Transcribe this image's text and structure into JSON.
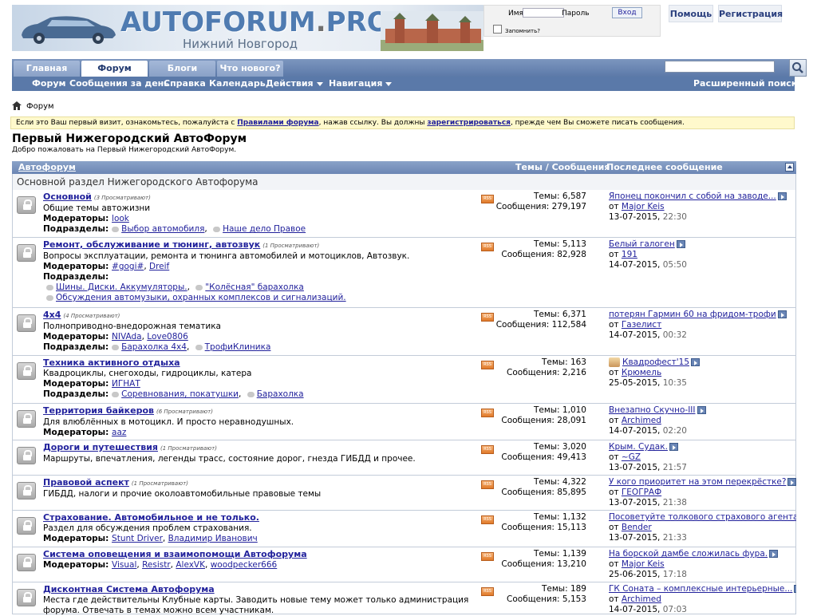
{
  "header": {
    "logo_text": "AUTOFORUM",
    "logo_dot": ".",
    "logo_suffix": "PRO",
    "logo_subtitle": "Нижний Новгород",
    "login": {
      "username_label": "Имя",
      "password_label": "Пароль",
      "login_button": "Вход",
      "remember_label": "Запомнить?"
    },
    "help_link": "Помощь",
    "register_link": "Регистрация"
  },
  "nav": {
    "tabs": [
      "Главная",
      "Форум",
      "Блоги",
      "Что нового?"
    ],
    "active_tab": "Форум",
    "subnav": [
      "Форум",
      "Сообщения за день",
      "Справка",
      "Календарь",
      "Действия",
      "Навигация"
    ],
    "advanced_search": "Расширенный поиск"
  },
  "breadcrumb": "Форум",
  "notice": {
    "part1": "Если это Ваш первый визит, ознакомьтесь, пожалуйста с ",
    "link1": "Правилами форума",
    "part2": ", нажав ссылку. Вы должны ",
    "link2": "зарегистрироваться",
    "part3": ", прежде чем Вы сможете писать сообщения."
  },
  "page": {
    "title": "Первый Нижегородский АвтоФорум",
    "subtitle": "Добро пожаловать на Первый Нижегородский АвтоФорум."
  },
  "forum_table": {
    "category": "Автофорум",
    "col_threads_posts": "Темы / Сообщения",
    "col_last_post": "Последнее сообщение",
    "category_desc": "Основной раздел Нижегородского Автофорума",
    "labels": {
      "moderators": "Модераторы:",
      "subforums": "Подразделы:",
      "threads": "Темы:",
      "posts": "Сообщения:",
      "from": "от",
      "rss": "RSS"
    },
    "forums": [
      {
        "title": "Основной",
        "viewing": "(3 Просматривают)",
        "desc": "Общие темы автожизни",
        "moderators": [
          "look"
        ],
        "subforums": [
          [
            "Выбор автомобиля",
            "Наше дело Правое"
          ]
        ],
        "threads": "6,587",
        "posts": "279,197",
        "last_title": "Японец покончил с собой на заводе...",
        "last_user": "Major Keis",
        "last_date": "13-07-2015,",
        "last_time": "22:30",
        "height": 60
      },
      {
        "title": "Ремонт, обслуживание и тюнинг, автозвук",
        "viewing": "(1 Просматривают)",
        "desc": "Вопросы эксплуатации, ремонта и тюнинга автомобилей и мотоциклов, Автозвук.",
        "moderators": [
          "#gogi#",
          "Dreif"
        ],
        "subforums_newline": true,
        "subforums": [
          [
            "Шины. Диски. Аккумуляторы.",
            "\"Колёсная\" барахолка"
          ],
          [
            "Обсуждения автомузыки, охранных комплексов и сигнализаций."
          ]
        ],
        "threads": "5,113",
        "posts": "82,928",
        "last_title": "Белый галоген",
        "last_user": "191",
        "last_date": "14-07-2015,",
        "last_time": "05:50",
        "height": 88
      },
      {
        "title": "4x4",
        "viewing": "(4 Просматривают)",
        "desc": "Полноприводно-внедорожная тематика",
        "moderators": [
          "NIVAda",
          "Love0806"
        ],
        "subforums": [
          [
            "Барахолка 4x4",
            "ТрофиКлиника"
          ]
        ],
        "threads": "6,371",
        "posts": "112,584",
        "last_title": "потерян Гармин 60 на фридом-трофи",
        "last_user": "Газелист",
        "last_date": "14-07-2015,",
        "last_time": "00:32",
        "height": 60
      },
      {
        "title": "Техника активного отдыха",
        "viewing": "",
        "desc": "Квадроциклы, снегоходы, гидроциклы, катера",
        "moderators": [
          "ИГНАТ"
        ],
        "subforums": [
          [
            "Соревнования, покатушки",
            "Барахолка"
          ]
        ],
        "threads": "163",
        "posts": "2,216",
        "last_title": "Квадрофест'15",
        "last_user": "Крюмель",
        "last_icon": true,
        "last_date": "25-05-2015,",
        "last_time": "10:35",
        "height": 60
      },
      {
        "title": "Территория байкеров",
        "viewing": "(6 Просматривают)",
        "desc": "Для влюблённых в мотоцикл. И просто неравнодушных.",
        "moderators": [
          "aaz"
        ],
        "subforums": [],
        "threads": "1,010",
        "posts": "28,091",
        "last_title": "Внезапно Скучно-III",
        "last_user": "Archimed",
        "last_date": "14-07-2015,",
        "last_time": "02:20",
        "height": 46
      },
      {
        "title": "Дороги и путешествия",
        "viewing": "(1 Просматривают)",
        "desc": "Маршруты, впечатления, легенды трасс, состояние дорог, гнезда ГИБДД и прочее.",
        "moderators": [],
        "subforums": [],
        "threads": "3,020",
        "posts": "49,413",
        "last_title": "Крым. Судак.",
        "last_user": "~GZ",
        "last_date": "13-07-2015,",
        "last_time": "21:57",
        "height": 44
      },
      {
        "title": "Правовой аспект",
        "viewing": "(1 Просматривают)",
        "desc": "ГИБДД, налоги и прочие околоавтомобильные правовые темы",
        "moderators": [],
        "subforums": [],
        "threads": "4,322",
        "posts": "85,895",
        "last_title": "У кого приоритет на этом перекрёстке?",
        "last_user": "ГЕОГРАФ",
        "last_date": "13-07-2015,",
        "last_time": "21:38",
        "height": 44
      },
      {
        "title": "Страхование. Автомобильное и не только.",
        "viewing": "",
        "desc": "Раздел для обсуждения проблем страхования.",
        "moderators": [
          "Stunt Driver",
          "Владимир Иванович"
        ],
        "subforums": [],
        "threads": "1,132",
        "posts": "15,113",
        "last_title": "Посоветуйте толкового страхового агента",
        "last_user": "Bender",
        "last_date": "13-07-2015,",
        "last_time": "21:33",
        "height": 46
      },
      {
        "title": "Система оповещения и взаимопомощи Автофорума",
        "viewing": "",
        "desc": "",
        "moderators": [
          "Visual",
          "Resistr",
          "AlexVK",
          "woodpecker666"
        ],
        "subforums": [],
        "threads": "1,139",
        "posts": "13,210",
        "last_title": "На борской дамбе сложилась фура.",
        "last_user": "Major Keis",
        "last_date": "25-06-2015,",
        "last_time": "17:18",
        "height": 44
      },
      {
        "title": "Дисконтная Система Автофорума",
        "viewing": "",
        "desc": "Места где действительны Клубные карты. Заводить новые тему может только администрация",
        "desc2": "форума. Отвечать в темах можно всем участникам.",
        "moderators": [],
        "subforums": [],
        "threads": "189",
        "posts": "5,153",
        "last_title": "ГК Соната – комплексные интерьерные...",
        "last_user": "Archimed",
        "last_date": "14-07-2015,",
        "last_time": "07:03",
        "height": 40
      }
    ]
  }
}
